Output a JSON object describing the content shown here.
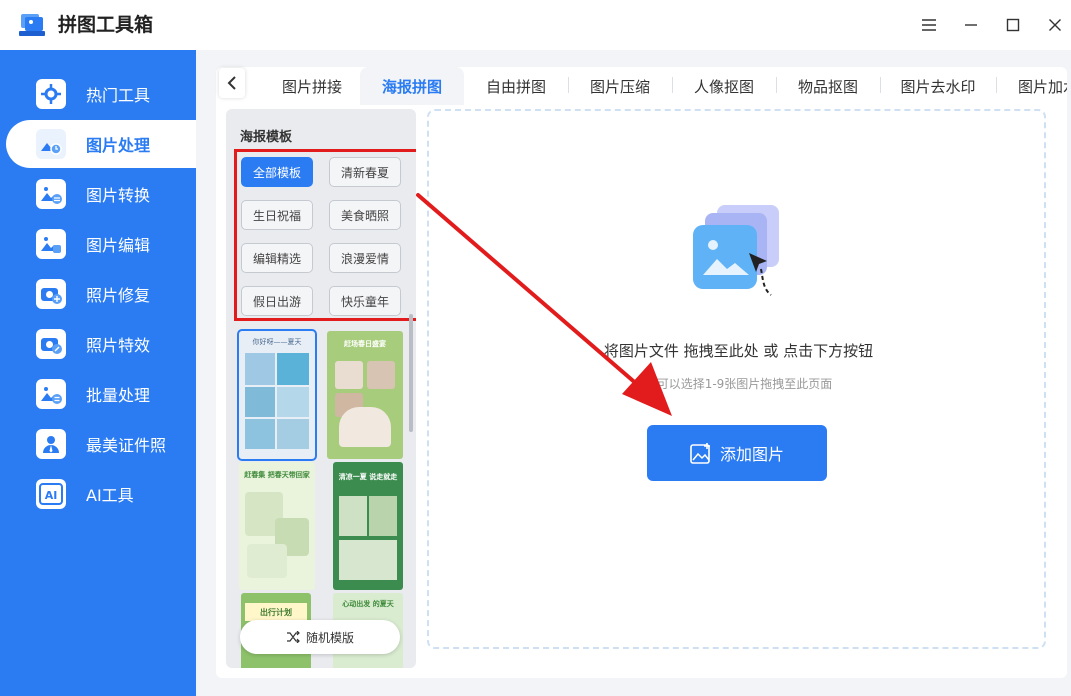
{
  "app": {
    "title": "拼图工具箱"
  },
  "window": {
    "menu_icon": "hamburger-icon",
    "minimize_icon": "minimize-icon",
    "maximize_icon": "maximize-icon",
    "close_icon": "close-icon"
  },
  "sidebar": {
    "items": [
      {
        "label": "热门工具",
        "icon": "tools-icon"
      },
      {
        "label": "图片处理",
        "icon": "image-process-icon",
        "active": true
      },
      {
        "label": "图片转换",
        "icon": "image-convert-icon"
      },
      {
        "label": "图片编辑",
        "icon": "image-edit-icon"
      },
      {
        "label": "照片修复",
        "icon": "photo-repair-icon"
      },
      {
        "label": "照片特效",
        "icon": "photo-effect-icon"
      },
      {
        "label": "批量处理",
        "icon": "batch-icon"
      },
      {
        "label": "最美证件照",
        "icon": "id-photo-icon"
      },
      {
        "label": "AI工具",
        "icon": "ai-icon"
      }
    ]
  },
  "tabs": [
    "图片拼接",
    "海报拼图",
    "自由拼图",
    "图片压缩",
    "人像抠图",
    "物品抠图",
    "图片去水印",
    "图片加水印"
  ],
  "active_tab": "海报拼图",
  "template_panel": {
    "title": "海报模板",
    "chips": [
      "全部模板",
      "清新春夏",
      "生日祝福",
      "美食晒照",
      "编辑精选",
      "浪漫爱情",
      "假日出游",
      "快乐童年"
    ],
    "thumbs": [
      {
        "caption": "你好呀——夏天"
      },
      {
        "caption": "赶场春日盛宴"
      },
      {
        "caption": "赶春集 把春天带回家"
      },
      {
        "caption": "清凉一夏 说走就走"
      },
      {
        "caption": "出行计划"
      },
      {
        "caption": "心动出发 的夏天"
      }
    ],
    "random_label": "随机模版"
  },
  "dropzone": {
    "main_text": "将图片文件 拖拽至此处 或 点击下方按钮",
    "sub_text": "您可以选择1-9张图片拖拽至此页面",
    "button_label": "添加图片"
  },
  "colors": {
    "accent": "#2b7cf3",
    "highlight": "#e21c1c"
  }
}
